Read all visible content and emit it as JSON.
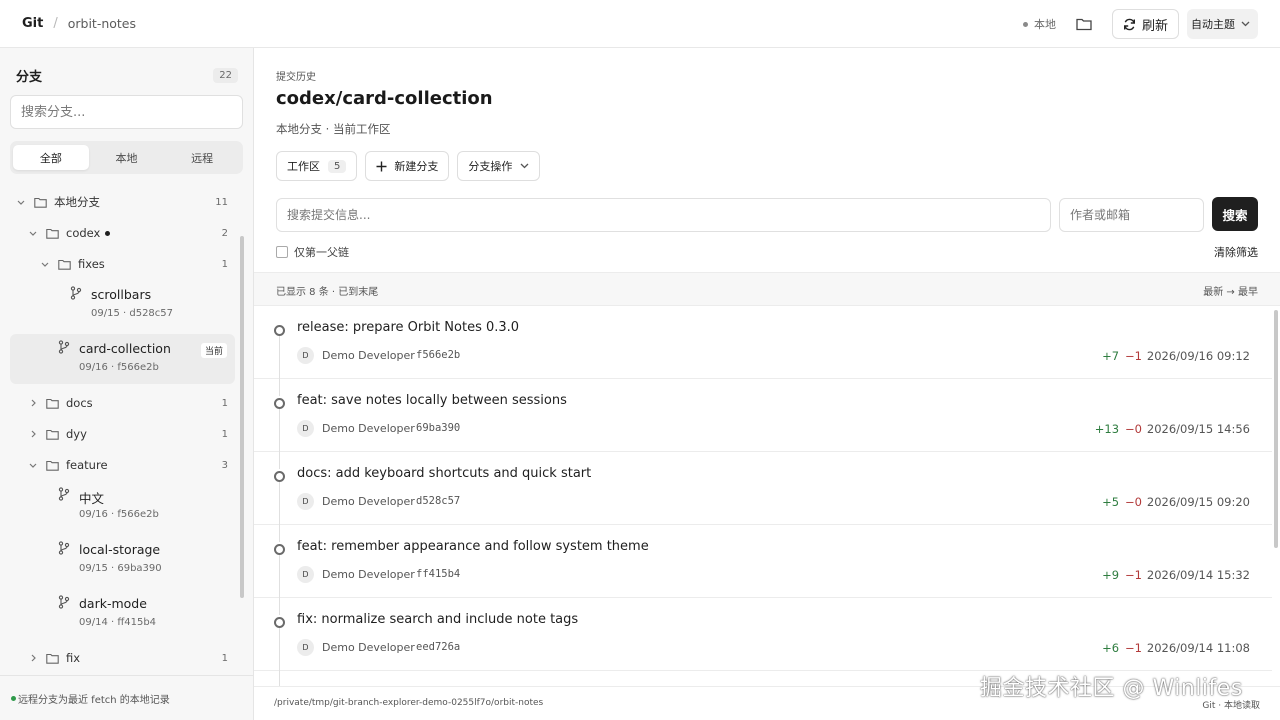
{
  "topbar": {
    "brand": "Git",
    "separator": "/",
    "repo": "orbit-notes",
    "local_label": "本地",
    "refresh_label": "刷新",
    "theme_label": "自动主题"
  },
  "sidebar": {
    "title": "分支",
    "count": "22",
    "search_placeholder": "搜索分支...",
    "tabs": [
      {
        "label": "全部",
        "active": true
      },
      {
        "label": "本地",
        "active": false
      },
      {
        "label": "远程",
        "active": false
      }
    ],
    "tree": {
      "local_branches": {
        "label": "本地分支",
        "count": "11"
      },
      "codex": {
        "label": "codex",
        "count": "2"
      },
      "fixes": {
        "label": "fixes",
        "count": "1"
      },
      "scrollbars": {
        "name": "scrollbars",
        "meta": "09/15 · d528c57"
      },
      "card_collection": {
        "name": "card-collection",
        "meta": "09/16 · f566e2b",
        "badge": "当前"
      },
      "docs": {
        "label": "docs",
        "count": "1"
      },
      "dyy": {
        "label": "dyy",
        "count": "1"
      },
      "feature": {
        "label": "feature",
        "count": "3"
      },
      "zhongwen": {
        "name": "中文",
        "meta": "09/16 · f566e2b"
      },
      "local_storage": {
        "name": "local-storage",
        "meta": "09/15 · 69ba390"
      },
      "dark_mode": {
        "name": "dark-mode",
        "meta": "09/14 · ff415b4"
      },
      "fix": {
        "label": "fix",
        "count": "1"
      }
    },
    "footer": "远程分支为最近 fetch 的本地记录"
  },
  "main": {
    "eyebrow": "提交历史",
    "title": "codex/card-collection",
    "subtitle": "本地分支 · 当前工作区",
    "worktree_label": "工作区",
    "worktree_count": "5",
    "new_branch_label": "新建分支",
    "branch_ops_label": "分支操作",
    "search_placeholder": "搜索提交信息...",
    "author_placeholder": "作者或邮箱",
    "search_button": "搜索",
    "first_parent_label": "仅第一父链",
    "clear_filters": "清除筛选",
    "list_status": "已显示 8 条 · 已到末尾",
    "sort_label": "最新 → 最早",
    "commits": [
      {
        "message": "release: prepare Orbit Notes 0.3.0",
        "avatar": "D",
        "author": "Demo Developer",
        "hash": "f566e2b",
        "add": "+7",
        "del": "−1",
        "date": "2026/09/16 09:12"
      },
      {
        "message": "feat: save notes locally between sessions",
        "avatar": "D",
        "author": "Demo Developer",
        "hash": "69ba390",
        "add": "+13",
        "del": "−0",
        "date": "2026/09/15 14:56"
      },
      {
        "message": "docs: add keyboard shortcuts and quick start",
        "avatar": "D",
        "author": "Demo Developer",
        "hash": "d528c57",
        "add": "+5",
        "del": "−0",
        "date": "2026/09/15 09:20"
      },
      {
        "message": "feat: remember appearance and follow system theme",
        "avatar": "D",
        "author": "Demo Developer",
        "hash": "ff415b4",
        "add": "+9",
        "del": "−1",
        "date": "2026/09/14 15:32"
      },
      {
        "message": "fix: normalize search and include note tags",
        "avatar": "D",
        "author": "Demo Developer",
        "hash": "eed726a",
        "add": "+6",
        "del": "−1",
        "date": "2026/09/14 11:08"
      }
    ],
    "footer_path": "/private/tmp/git-branch-explorer-demo-0255lf7o/orbit-notes",
    "footer_right": "Git · 本地读取"
  },
  "watermark": "掘金技术社区 @ Winlifes",
  "colors": {
    "accent": "#1f1f1f",
    "additions": "#2f7d40",
    "deletions": "#b23a3a",
    "sidebar_bg": "#f7f7f7"
  }
}
